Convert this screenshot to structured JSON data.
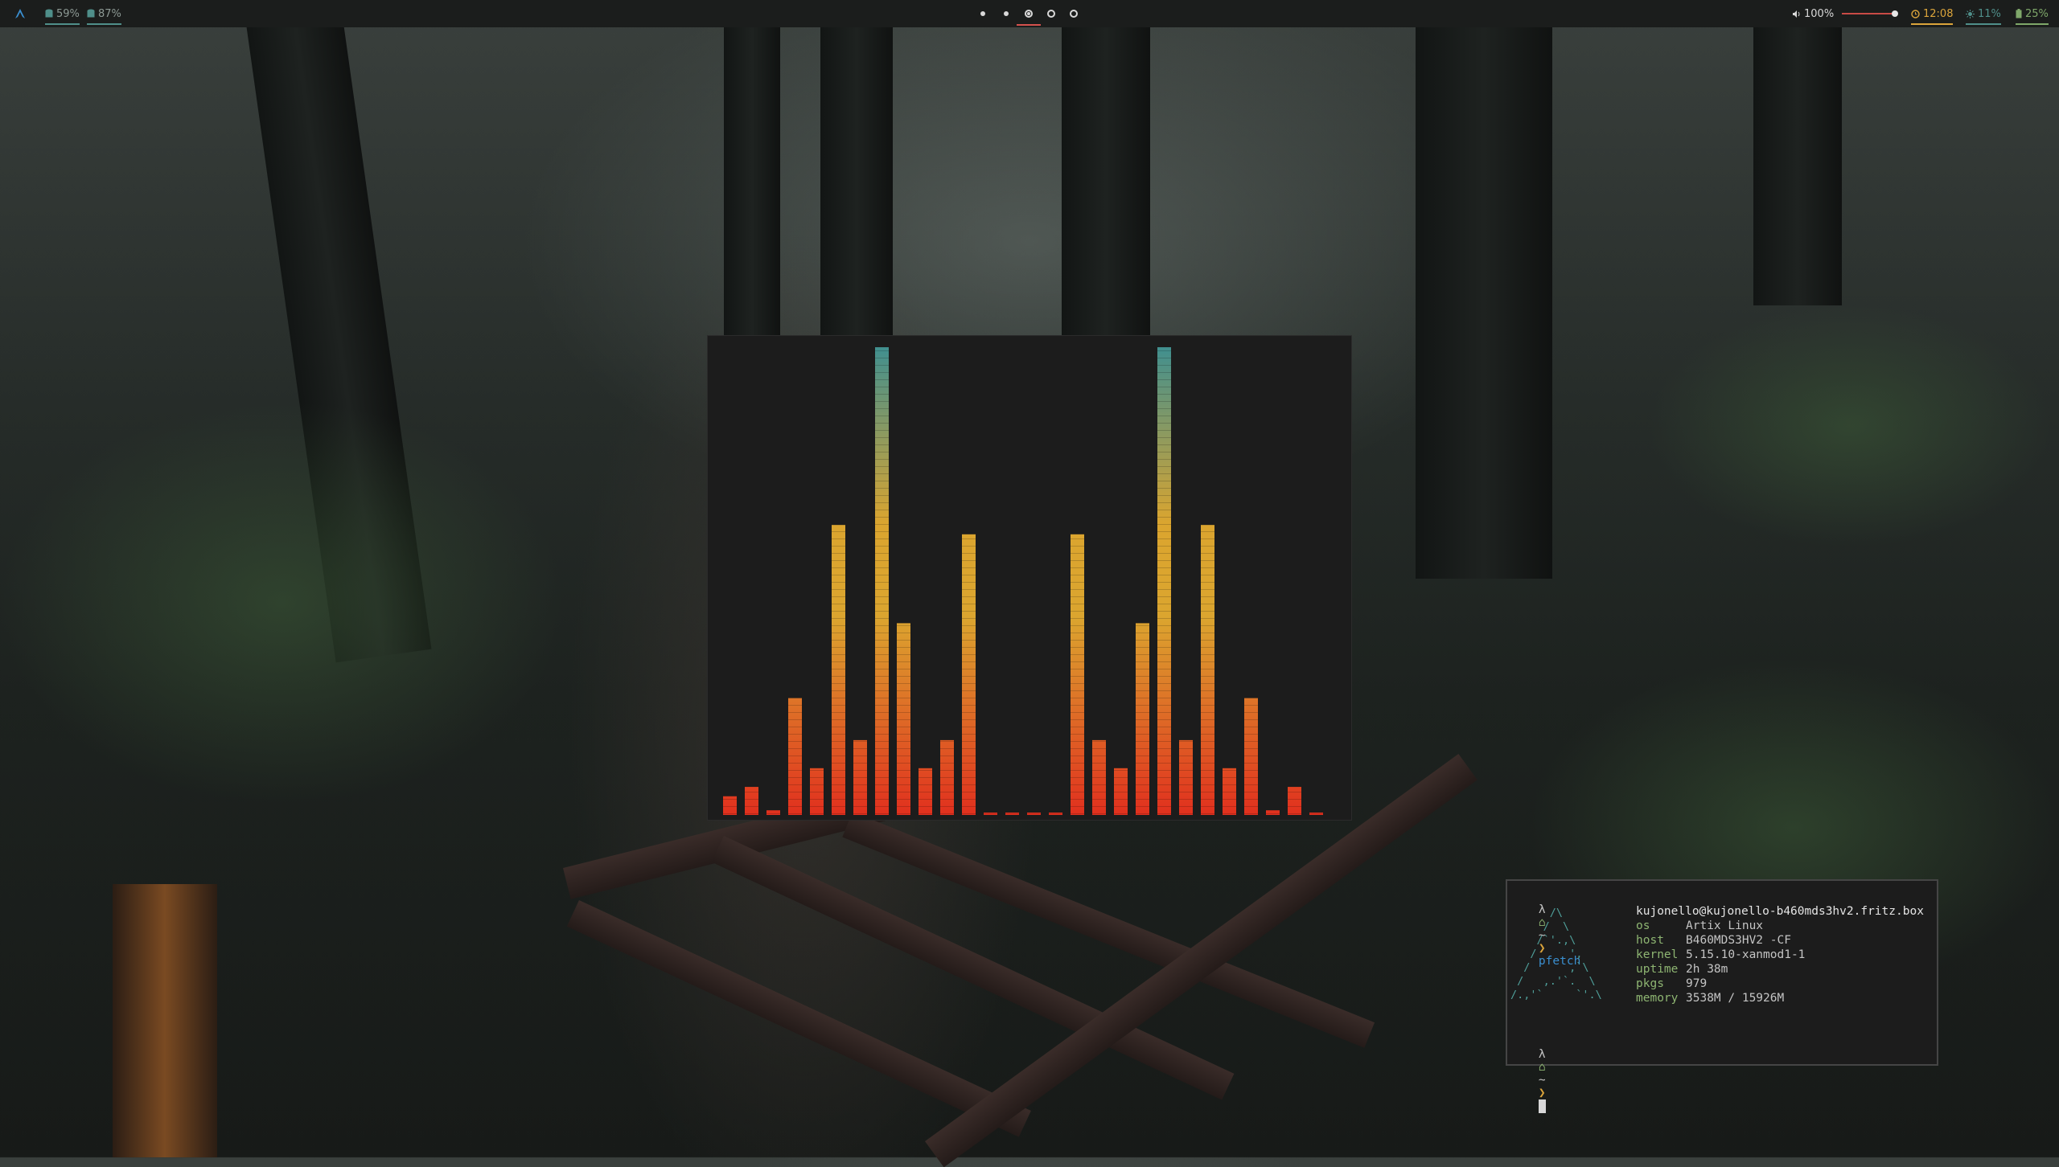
{
  "bar": {
    "launcher_icon": "artix-logo-icon",
    "modules_left": [
      {
        "icon": "database-icon",
        "value": "59%"
      },
      {
        "icon": "database-icon",
        "value": "87%"
      }
    ],
    "workspaces": [
      {
        "state": "occupied"
      },
      {
        "state": "occupied"
      },
      {
        "state": "focused"
      },
      {
        "state": "empty"
      },
      {
        "state": "empty"
      }
    ],
    "volume": {
      "icon": "speaker-icon",
      "value": "100%",
      "level": 1.0
    },
    "clock": {
      "icon": "clock-icon",
      "value": "12:08"
    },
    "brightness": {
      "icon": "sun-icon",
      "value": "11%"
    },
    "battery": {
      "icon": "battery-icon",
      "value": "25%"
    },
    "colors": {
      "accent": "#d5524d",
      "teal": "#4f8f8a",
      "yellow": "#dca53b",
      "green": "#7fa86a"
    }
  },
  "visualizer": {
    "bars": [
      0.04,
      0.06,
      0.01,
      0.25,
      0.1,
      0.62,
      0.16,
      1.0,
      0.41,
      0.1,
      0.16,
      0.6,
      0.0,
      0.0,
      0.0,
      0.0,
      0.6,
      0.16,
      0.1,
      0.41,
      1.0,
      0.16,
      0.62,
      0.1,
      0.25,
      0.01,
      0.06,
      0.0
    ],
    "colors": {
      "top": "#3f8f90",
      "mid": "#dba52f",
      "bottom": "#e1301e"
    }
  },
  "terminal": {
    "prompt_symbols": "λ",
    "prompt_dir": "~",
    "prompt_arrow": "❯",
    "command": "pfetch",
    "user_host": "kujonello@kujonello-b460mds3hv2.fritz.box",
    "info": [
      {
        "key": "os",
        "value": "Artix Linux"
      },
      {
        "key": "host",
        "value": "B460MDS3HV2 -CF"
      },
      {
        "key": "kernel",
        "value": "5.15.10-xanmod1-1"
      },
      {
        "key": "uptime",
        "value": "2h 38m"
      },
      {
        "key": "pkgs",
        "value": "979"
      },
      {
        "key": "memory",
        "value": "3538M / 15926M"
      }
    ],
    "logo": [
      "      /\\",
      "     /  \\",
      "    /`'.,\\",
      "   /     ',",
      "  /      ,`\\",
      " /   ,.'`.  \\",
      "/.,'`     `'.\\"
    ]
  }
}
